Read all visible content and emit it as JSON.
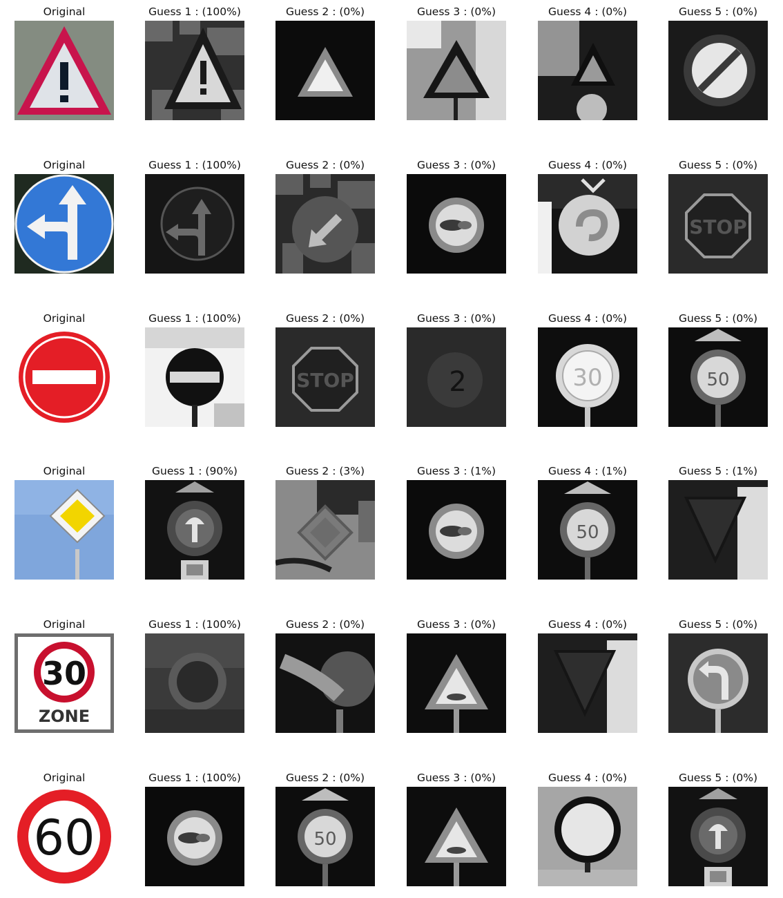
{
  "rows": [
    {
      "original_label": "Original",
      "original_sign": "warning-exclamation",
      "guesses": [
        {
          "label": "Guess 1 : (100%)",
          "probability": 1.0,
          "sign": "general-caution"
        },
        {
          "label": "Guess 2 : (0%)",
          "probability": 0.0,
          "sign": "traffic-signals"
        },
        {
          "label": "Guess 3 : (0%)",
          "probability": 0.0,
          "sign": "pedestrians"
        },
        {
          "label": "Guess 4 : (0%)",
          "probability": 0.0,
          "sign": "dangerous-curve"
        },
        {
          "label": "Guess 5 : (0%)",
          "probability": 0.0,
          "sign": "end-of-all-limits"
        }
      ]
    },
    {
      "original_label": "Original",
      "original_sign": "go-straight-or-left",
      "guesses": [
        {
          "label": "Guess 1 : (100%)",
          "probability": 1.0,
          "sign": "go-straight-or-left"
        },
        {
          "label": "Guess 2 : (0%)",
          "probability": 0.0,
          "sign": "keep-left"
        },
        {
          "label": "Guess 3 : (0%)",
          "probability": 0.0,
          "sign": "no-passing"
        },
        {
          "label": "Guess 4 : (0%)",
          "probability": 0.0,
          "sign": "roundabout"
        },
        {
          "label": "Guess 5 : (0%)",
          "probability": 0.0,
          "sign": "stop"
        }
      ]
    },
    {
      "original_label": "Original",
      "original_sign": "no-entry",
      "guesses": [
        {
          "label": "Guess 1 : (100%)",
          "probability": 1.0,
          "sign": "no-entry"
        },
        {
          "label": "Guess 2 : (0%)",
          "probability": 0.0,
          "sign": "stop"
        },
        {
          "label": "Guess 3 : (0%)",
          "probability": 0.0,
          "sign": "speed-limit-20"
        },
        {
          "label": "Guess 4 : (0%)",
          "probability": 0.0,
          "sign": "speed-limit-30"
        },
        {
          "label": "Guess 5 : (0%)",
          "probability": 0.0,
          "sign": "speed-limit-50"
        }
      ]
    },
    {
      "original_label": "Original",
      "original_sign": "priority-road",
      "guesses": [
        {
          "label": "Guess 1 : (90%)",
          "probability": 0.9,
          "sign": "circle-with-plate"
        },
        {
          "label": "Guess 2 : (3%)",
          "probability": 0.03,
          "sign": "priority-road"
        },
        {
          "label": "Guess 3 : (1%)",
          "probability": 0.01,
          "sign": "no-passing"
        },
        {
          "label": "Guess 4 : (1%)",
          "probability": 0.01,
          "sign": "speed-limit-50"
        },
        {
          "label": "Guess 5 : (1%)",
          "probability": 0.01,
          "sign": "yield"
        }
      ]
    },
    {
      "original_label": "Original",
      "original_sign": "speed-zone-30",
      "guesses": [
        {
          "label": "Guess 1 : (100%)",
          "probability": 1.0,
          "sign": "blurry-circle"
        },
        {
          "label": "Guess 2 : (0%)",
          "probability": 0.0,
          "sign": "curve-arrow"
        },
        {
          "label": "Guess 3 : (0%)",
          "probability": 0.0,
          "sign": "road-work"
        },
        {
          "label": "Guess 4 : (0%)",
          "probability": 0.0,
          "sign": "yield"
        },
        {
          "label": "Guess 5 : (0%)",
          "probability": 0.0,
          "sign": "turn-left"
        }
      ]
    },
    {
      "original_label": "Original",
      "original_sign": "speed-limit-60",
      "guesses": [
        {
          "label": "Guess 1 : (100%)",
          "probability": 1.0,
          "sign": "no-passing"
        },
        {
          "label": "Guess 2 : (0%)",
          "probability": 0.0,
          "sign": "speed-limit-50"
        },
        {
          "label": "Guess 3 : (0%)",
          "probability": 0.0,
          "sign": "road-work"
        },
        {
          "label": "Guess 4 : (0%)",
          "probability": 0.0,
          "sign": "no-vehicles"
        },
        {
          "label": "Guess 5 : (0%)",
          "probability": 0.0,
          "sign": "circle-with-plate"
        }
      ]
    }
  ]
}
